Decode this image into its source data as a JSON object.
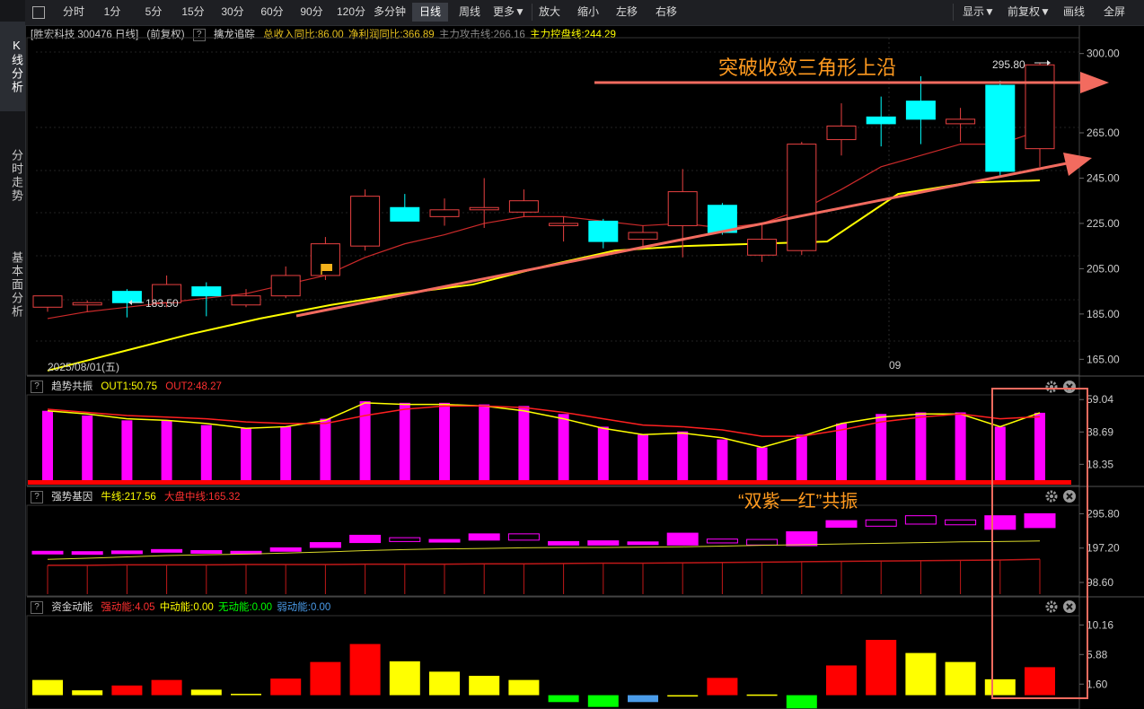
{
  "sidebar": {
    "tabs": [
      {
        "label": "K线分析",
        "active": true
      },
      {
        "label": "分时走势",
        "active": false
      },
      {
        "label": "基本面分析",
        "active": false
      }
    ]
  },
  "toolbar": {
    "periods": [
      "分时",
      "1分",
      "5分",
      "15分",
      "30分",
      "60分",
      "90分",
      "120分",
      "多分钟",
      "日线",
      "周线",
      "更多▼"
    ],
    "active_period": "日线",
    "actions": [
      "放大",
      "缩小",
      "左移",
      "右移"
    ],
    "right": [
      "显示▼",
      "前复权▼",
      "画线",
      "全屏"
    ]
  },
  "main_legend": {
    "stock": "[胜宏科技 300476 日线]",
    "adjust": "(前复权)",
    "indicator": "擒龙追踪",
    "revenue_label": "总收入同比:86.00",
    "profit_label": "净利润同比:366.89",
    "attack_label": "主力攻击线:266.16",
    "control_label": "主力控盘线:244.29"
  },
  "annotations": {
    "breakout": "突破收敛三角形上沿",
    "resonance": "“双紫一红”共振",
    "high_label": "295.80",
    "low_label": "183.50"
  },
  "date_labels": {
    "start": "2025/08/01(五)",
    "month": "09"
  },
  "panels": {
    "trend": {
      "name": "趋势共振",
      "out1": "OUT1:50.75",
      "out2": "OUT2:48.27"
    },
    "strong": {
      "name": "强势基因",
      "bull": "牛线:217.56",
      "market": "大盘中线:165.32"
    },
    "fund": {
      "name": "资金动能",
      "strong": "强动能:4.05",
      "mid": "中动能:0.00",
      "none": "无动能:0.00",
      "weak": "弱动能:0.00"
    }
  },
  "colors": {
    "up": "#e84141",
    "down": "#00ffff",
    "magenta": "#ff00ff",
    "yellow": "#ffff00",
    "red": "#ff0000",
    "green": "#00ff00",
    "blue": "#4a9be8",
    "annot": "#f26b5f",
    "orange_text": "#ff9a1f"
  },
  "chart_data": [
    {
      "type": "candlestick",
      "title": "",
      "ylim": [
        158,
        307
      ],
      "y_ticks": [
        300.0,
        265.0,
        245.0,
        225.0,
        205.0,
        185.0,
        165.0
      ],
      "candles": [
        {
          "o": 188,
          "h": 193,
          "l": 186,
          "c": 193
        },
        {
          "o": 189,
          "h": 191,
          "l": 186,
          "c": 190
        },
        {
          "o": 195,
          "h": 196,
          "l": 183.5,
          "c": 190
        },
        {
          "o": 190,
          "h": 202,
          "l": 188,
          "c": 198
        },
        {
          "o": 197,
          "h": 199,
          "l": 184,
          "c": 193
        },
        {
          "o": 189,
          "h": 196,
          "l": 188,
          "c": 193
        },
        {
          "o": 193,
          "h": 206,
          "l": 192,
          "c": 202
        },
        {
          "o": 202,
          "h": 219,
          "l": 200,
          "c": 216
        },
        {
          "o": 215,
          "h": 240,
          "l": 213,
          "c": 237
        },
        {
          "o": 232,
          "h": 238,
          "l": 226,
          "c": 226
        },
        {
          "o": 228,
          "h": 236,
          "l": 224,
          "c": 231
        },
        {
          "o": 231,
          "h": 245,
          "l": 223,
          "c": 232
        },
        {
          "o": 230,
          "h": 240,
          "l": 228,
          "c": 235
        },
        {
          "o": 224,
          "h": 228,
          "l": 217,
          "c": 225
        },
        {
          "o": 226,
          "h": 227,
          "l": 214,
          "c": 217
        },
        {
          "o": 218,
          "h": 224,
          "l": 214,
          "c": 221
        },
        {
          "o": 224,
          "h": 249,
          "l": 210,
          "c": 239
        },
        {
          "o": 233,
          "h": 234,
          "l": 220,
          "c": 221
        },
        {
          "o": 211,
          "h": 225,
          "l": 208,
          "c": 218
        },
        {
          "o": 213,
          "h": 261,
          "l": 211,
          "c": 260
        },
        {
          "o": 262,
          "h": 278,
          "l": 255,
          "c": 268
        },
        {
          "o": 272,
          "h": 281,
          "l": 259,
          "c": 269
        },
        {
          "o": 279,
          "h": 290,
          "l": 260,
          "c": 271
        },
        {
          "o": 269,
          "h": 276,
          "l": 261,
          "c": 271
        },
        {
          "o": 286,
          "h": 288,
          "l": 246,
          "c": 248
        },
        {
          "o": 258,
          "h": 295.8,
          "l": 250,
          "c": 295
        }
      ],
      "lines": [
        {
          "name": "主力攻击线",
          "color": "#cc2a2a",
          "values": [
            183,
            186,
            188,
            190,
            192,
            194,
            198,
            202,
            210,
            216,
            220,
            225,
            228,
            228,
            226,
            224,
            225,
            223,
            225,
            231,
            240,
            250,
            255,
            260,
            260,
            266
          ]
        },
        {
          "name": "主力控盘线",
          "color": "#ffff00",
          "values": [
            160,
            168,
            176,
            183,
            189,
            194,
            198,
            206,
            213,
            215,
            216,
            217,
            238,
            243,
            244
          ]
        }
      ]
    },
    {
      "type": "bar",
      "title": "",
      "ylim": [
        5,
        62
      ],
      "y_ticks": [
        59.04,
        38.69,
        18.35
      ],
      "values": [
        52,
        49,
        46,
        46,
        43,
        41,
        42,
        47,
        58,
        57,
        57,
        56,
        55,
        50,
        42,
        37,
        39,
        34,
        29,
        37,
        44,
        50,
        51,
        51,
        42,
        50.75
      ],
      "out1": [
        52,
        50,
        47,
        46,
        44,
        41,
        42,
        46,
        57,
        56,
        56,
        55,
        52,
        47,
        41,
        37,
        38,
        35,
        29,
        36,
        44,
        48,
        50,
        50,
        42,
        50.75
      ],
      "out2": [
        53,
        51,
        49,
        48,
        47,
        45,
        44,
        44,
        49,
        53,
        55,
        55,
        54,
        51,
        47,
        43,
        42,
        40,
        36,
        36,
        40,
        45,
        48,
        50,
        47,
        48.27
      ]
    },
    {
      "type": "bar",
      "title": "",
      "ylim": [
        60,
        320
      ],
      "y_ticks": [
        295.8,
        197.2,
        98.6
      ],
      "candles": [
        {
          "o": 184,
          "h": 188,
          "l": 184,
          "c": 188
        },
        {
          "o": 182,
          "h": 187,
          "l": 182,
          "c": 187
        },
        {
          "o": 183,
          "h": 189,
          "l": 183,
          "c": 189
        },
        {
          "o": 186,
          "h": 193,
          "l": 186,
          "c": 193
        },
        {
          "o": 184,
          "h": 190,
          "l": 184,
          "c": 190
        },
        {
          "o": 184,
          "h": 188,
          "l": 184,
          "c": 188
        },
        {
          "o": 188,
          "h": 198,
          "l": 188,
          "c": 198
        },
        {
          "o": 199,
          "h": 213,
          "l": 199,
          "c": 213
        },
        {
          "o": 213,
          "h": 234,
          "l": 213,
          "c": 234
        },
        {
          "o": 216,
          "h": 227,
          "l": 216,
          "c": 227
        },
        {
          "o": 216,
          "h": 222,
          "l": 216,
          "c": 222
        },
        {
          "o": 220,
          "h": 238,
          "l": 220,
          "c": 238
        },
        {
          "o": 220,
          "h": 238,
          "l": 220,
          "c": 238
        },
        {
          "o": 206,
          "h": 216,
          "l": 206,
          "c": 216
        },
        {
          "o": 206,
          "h": 218,
          "l": 206,
          "c": 218
        },
        {
          "o": 208,
          "h": 215,
          "l": 208,
          "c": 215
        },
        {
          "o": 206,
          "h": 240,
          "l": 206,
          "c": 240
        },
        {
          "o": 212,
          "h": 223,
          "l": 212,
          "c": 223
        },
        {
          "o": 206,
          "h": 222,
          "l": 206,
          "c": 222
        },
        {
          "o": 204,
          "h": 244,
          "l": 204,
          "c": 244
        },
        {
          "o": 257,
          "h": 276,
          "l": 257,
          "c": 276
        },
        {
          "o": 260,
          "h": 278,
          "l": 260,
          "c": 278
        },
        {
          "o": 266,
          "h": 290,
          "l": 266,
          "c": 290
        },
        {
          "o": 264,
          "h": 278,
          "l": 264,
          "c": 278
        },
        {
          "o": 251,
          "h": 290,
          "l": 251,
          "c": 290
        },
        {
          "o": 256,
          "h": 295.8,
          "l": 256,
          "c": 295.8
        }
      ],
      "bull": [
        165,
        168,
        172,
        176,
        178,
        180,
        183,
        186,
        190,
        193,
        195,
        196,
        198,
        199,
        199,
        200,
        201,
        203,
        205,
        207,
        209,
        211,
        213,
        215,
        216,
        217.56
      ],
      "market": [
        148,
        148,
        149,
        149,
        149,
        150,
        150,
        150,
        151,
        151,
        151,
        152,
        152,
        153,
        154,
        154,
        155,
        156,
        157,
        158,
        159,
        160,
        161,
        162,
        163,
        165.32
      ]
    },
    {
      "type": "bar",
      "title": "",
      "ylim": [
        -2,
        11.5
      ],
      "y_ticks": [
        10.16,
        5.88,
        1.6
      ],
      "values": [
        2.2,
        0.7,
        1.4,
        2.2,
        0.8,
        0.2,
        2.4,
        4.8,
        7.4,
        4.9,
        3.4,
        2.8,
        2.2,
        -1.0,
        -1.7,
        -1.0,
        0.0,
        2.5,
        0.1,
        -1.9,
        4.3,
        8.0,
        6.1,
        4.8,
        2.3,
        4.05
      ],
      "colors": [
        "yellow",
        "yellow",
        "red",
        "red",
        "yellow",
        "yellow",
        "red",
        "red",
        "red",
        "yellow",
        "yellow",
        "yellow",
        "yellow",
        "green",
        "green",
        "blue",
        "yellow",
        "red",
        "yellow",
        "green",
        "red",
        "red",
        "yellow",
        "yellow",
        "yellow",
        "red"
      ]
    }
  ]
}
